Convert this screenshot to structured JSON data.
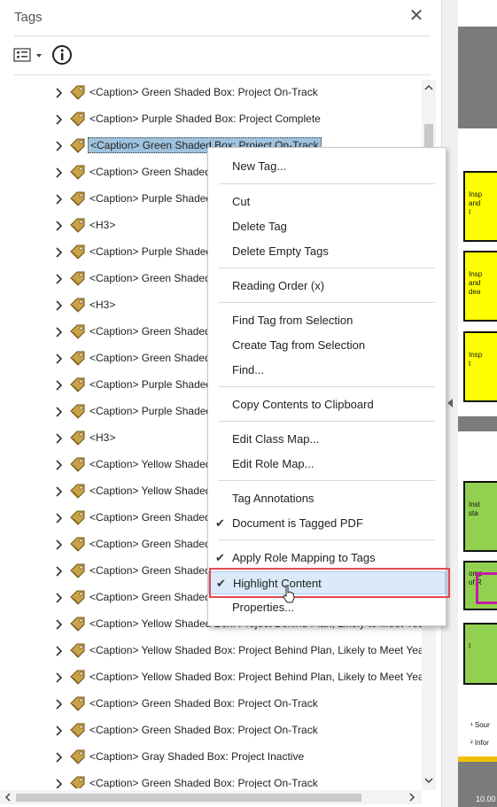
{
  "panel": {
    "title": "Tags",
    "close_glyph": "✕"
  },
  "tree": {
    "rows": [
      {
        "label": "<Caption> Green Shaded Box: Project On-Track"
      },
      {
        "label": "<Caption> Purple Shaded Box: Project Complete"
      },
      {
        "label": "<Caption> Green Shaded Box: Project On-Track",
        "selected": true
      },
      {
        "label": "<Caption> Green Shaded"
      },
      {
        "label": "<Caption> Purple Shaded"
      },
      {
        "label": "<H3>"
      },
      {
        "label": "<Caption> Purple Shaded"
      },
      {
        "label": "<Caption> Green Shaded"
      },
      {
        "label": "<H3>"
      },
      {
        "label": "<Caption> Green Shaded"
      },
      {
        "label": "<Caption> Green Shaded"
      },
      {
        "label": "<Caption> Purple Shaded"
      },
      {
        "label": "<Caption> Purple Shaded"
      },
      {
        "label": "<H3>"
      },
      {
        "label": "<Caption> Yellow Shaded"
      },
      {
        "label": "<Caption> Yellow Shaded"
      },
      {
        "label": "<Caption> Green Shaded"
      },
      {
        "label": "<Caption> Green Shaded"
      },
      {
        "label": "<Caption> Green Shaded"
      },
      {
        "label": "<Caption> Green Shaded"
      },
      {
        "label": "<Caption> Yellow Shaded Box: Project Behind Plan, Likely to Meet Year"
      },
      {
        "label": "<Caption> Yellow Shaded Box: Project Behind Plan, Likely to Meet Year"
      },
      {
        "label": "<Caption> Yellow Shaded Box: Project Behind Plan, Likely to Meet Year"
      },
      {
        "label": "<Caption> Green Shaded Box: Project On-Track"
      },
      {
        "label": "<Caption> Green Shaded Box: Project On-Track"
      },
      {
        "label": "<Caption> Gray Shaded Box: Project Inactive"
      },
      {
        "label": "<Caption> Green Shaded Box: Project On-Track"
      }
    ]
  },
  "context_menu": {
    "items": [
      {
        "label": "New Tag..."
      },
      {
        "label": "Cut"
      },
      {
        "label": "Delete Tag"
      },
      {
        "label": "Delete Empty Tags"
      },
      {
        "label": "Reading Order (x)"
      },
      {
        "label": "Find Tag from Selection"
      },
      {
        "label": "Create Tag from Selection"
      },
      {
        "label": "Find..."
      },
      {
        "label": "Copy Contents to Clipboard"
      },
      {
        "label": "Edit Class Map..."
      },
      {
        "label": "Edit Role Map..."
      },
      {
        "label": "Tag Annotations"
      },
      {
        "label": "Document is Tagged PDF",
        "checked": true
      },
      {
        "label": "Apply Role Mapping to Tags",
        "checked": true
      },
      {
        "label": "Highlight Content",
        "checked": true,
        "highlighted": true
      },
      {
        "label": "Properties..."
      }
    ],
    "check_glyph": "✔"
  },
  "document": {
    "boxes": [
      {
        "text": "Insp",
        "text2": "and",
        "text3": "I",
        "color": "yellow"
      },
      {
        "text": "Insp",
        "text2": "and",
        "text3": "dea",
        "color": "yellow"
      },
      {
        "text": "Insp",
        "text2": "t",
        "text3": "",
        "color": "yellow"
      },
      {
        "text": "Inst",
        "text2": "sta",
        "text3": "",
        "color": "green"
      },
      {
        "text": "omp",
        "text2": "of R",
        "text3": "",
        "color": "green"
      },
      {
        "text": "I",
        "text2": "",
        "text3": "",
        "color": "green"
      }
    ],
    "footnote1": "¹ Sour",
    "footnote2": "² Infor",
    "page_number": "10.00"
  },
  "colors": {
    "selection": "#9fc3df",
    "menu_highlight": "#dbe9f9",
    "annotation_red": "#e24850",
    "yellow_box": "#ffff00",
    "green_box": "#92d050"
  }
}
